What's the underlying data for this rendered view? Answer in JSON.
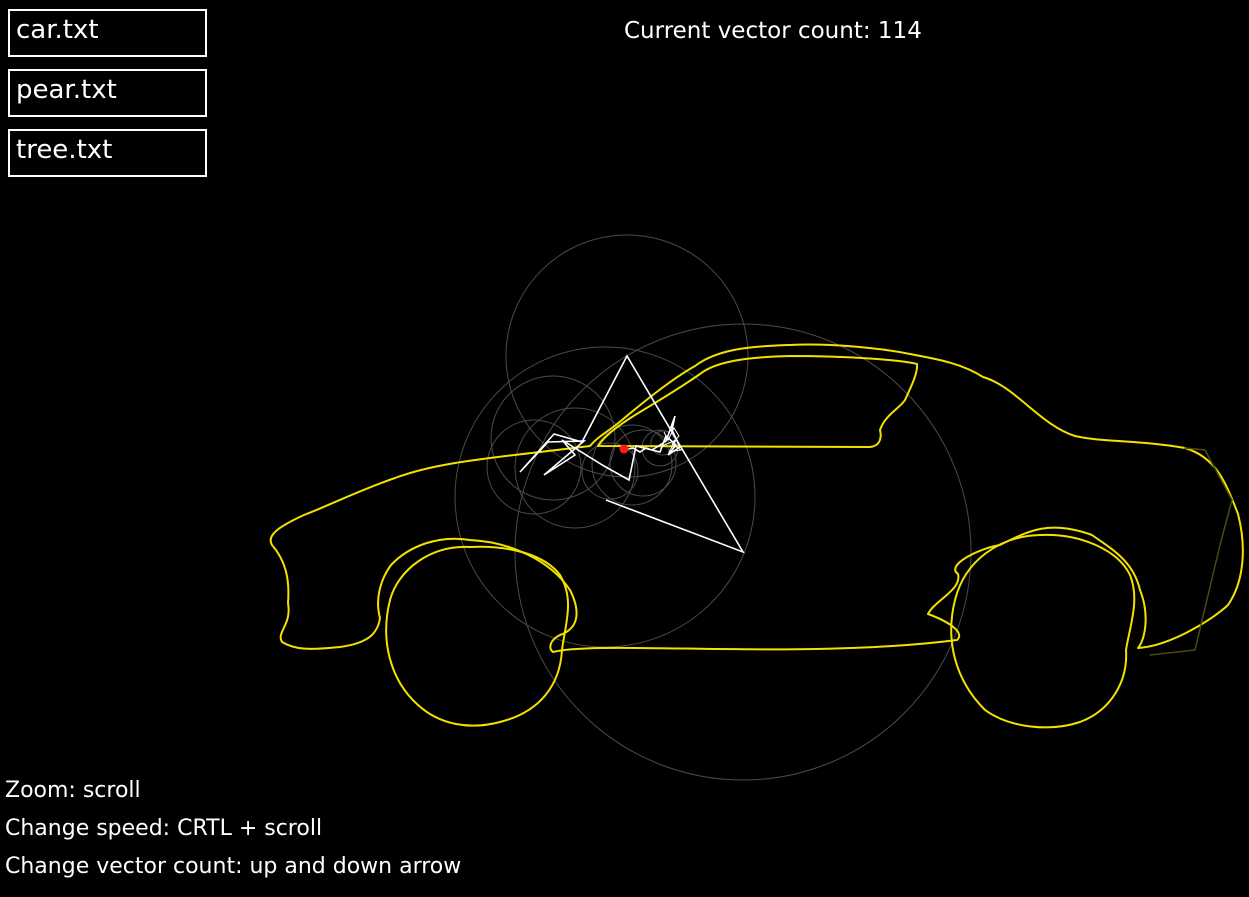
{
  "files": [
    {
      "label": "car.txt"
    },
    {
      "label": "pear.txt"
    },
    {
      "label": "tree.txt"
    }
  ],
  "status": {
    "vector_count_label": "Current vector count:",
    "vector_count": "114"
  },
  "help": {
    "zoom": "Zoom: scroll",
    "speed": "Change speed: CRTL + scroll",
    "vectors": "Change vector count: up and down arrow"
  },
  "colors": {
    "background": "#000000",
    "path": "#f2e200",
    "vectors": "#ffffff",
    "circles": "#4a4a4a",
    "pen": "#ff1a1a"
  }
}
